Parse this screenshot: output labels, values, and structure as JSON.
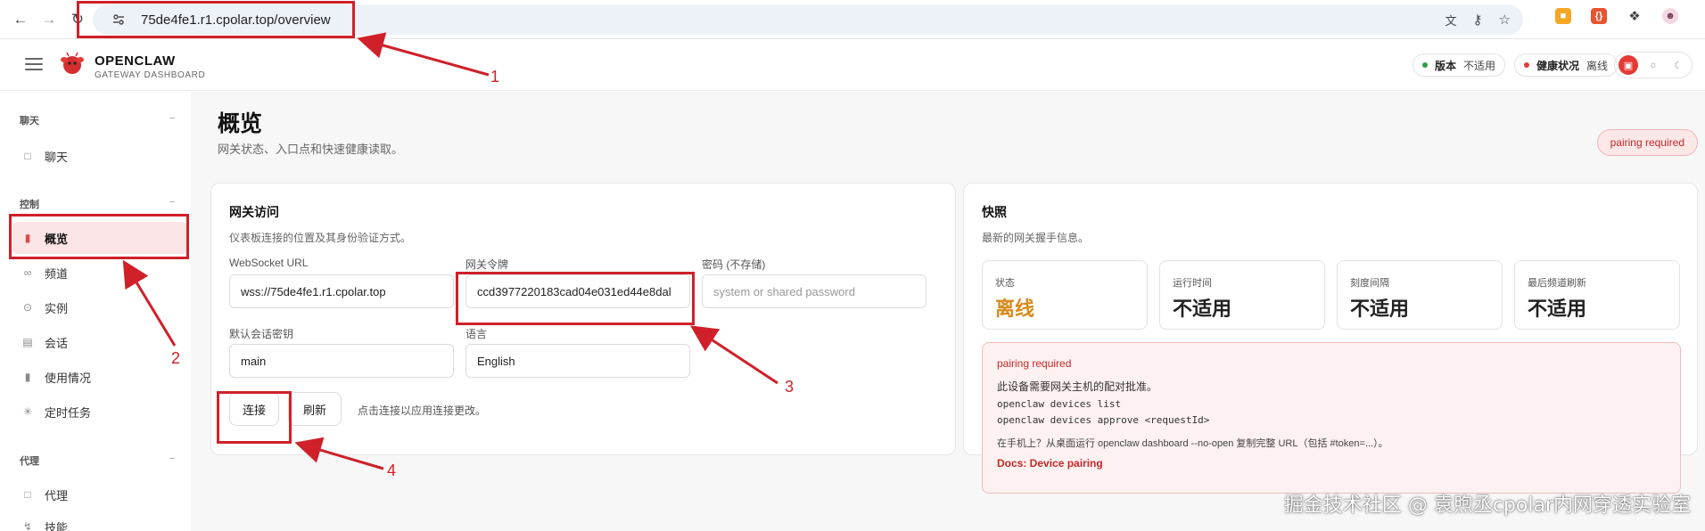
{
  "browser": {
    "url": "75de4fe1.r1.cpolar.top/overview",
    "back_icon": "arrow-left-icon",
    "forward_icon": "arrow-right-icon",
    "reload_icon": "reload-icon"
  },
  "topbar": {
    "brand_title": "OPENCLAW",
    "brand_sub": "GATEWAY DASHBOARD",
    "version_label": "版本",
    "version_value": "不适用",
    "health_label": "健康状况",
    "health_value": "离线",
    "colors": {
      "health_dot": "#e53935",
      "version_dot": "#2e9e44",
      "accent": "#e53935"
    }
  },
  "sidebar": {
    "groups": [
      {
        "label": "聊天",
        "collapse": "−",
        "items": [
          {
            "label": "聊天",
            "icon": "chat-icon"
          }
        ]
      },
      {
        "label": "控制",
        "collapse": "−",
        "items": [
          {
            "label": "概览",
            "icon": "bar-chart-icon",
            "active": true
          },
          {
            "label": "频道",
            "icon": "link-icon"
          },
          {
            "label": "实例",
            "icon": "broadcast-icon"
          },
          {
            "label": "会话",
            "icon": "document-icon"
          },
          {
            "label": "使用情况",
            "icon": "bar-chart-icon"
          },
          {
            "label": "定时任务",
            "icon": "loader-icon"
          }
        ]
      },
      {
        "label": "代理",
        "collapse": "−",
        "items": [
          {
            "label": "代理",
            "icon": "folder-icon"
          },
          {
            "label": "技能",
            "icon": "bolt-icon"
          }
        ]
      }
    ]
  },
  "page": {
    "title": "概览",
    "subtitle": "网关状态、入口点和快速健康读取。",
    "badge": "pairing required"
  },
  "gateway_card": {
    "title": "网关访问",
    "subtitle": "仪表板连接的位置及其身份验证方式。",
    "ws_label": "WebSocket URL",
    "ws_value": "wss://75de4fe1.r1.cpolar.top",
    "token_label": "网关令牌",
    "token_value": "ccd3977220183cad04e031ed44e8dal",
    "password_label": "密码 (不存储)",
    "password_placeholder": "system or shared password",
    "session_label": "默认会话密钥",
    "session_value": "main",
    "language_label": "语言",
    "language_value": "English",
    "connect_button": "连接",
    "refresh_button": "刷新",
    "hint": "点击连接以应用连接更改。"
  },
  "snapshot_card": {
    "title": "快照",
    "subtitle": "最新的网关握手信息。",
    "stats": [
      {
        "label": "状态",
        "value": "离线",
        "warn": true
      },
      {
        "label": "运行时间",
        "value": "不适用"
      },
      {
        "label": "刻度间隔",
        "value": "不适用"
      },
      {
        "label": "最后频道刷新",
        "value": "不适用"
      }
    ],
    "alert": {
      "title": "pairing required",
      "desc": "此设备需要网关主机的配对批准。",
      "code_line1": "openclaw devices list",
      "code_line2": "openclaw devices approve <requestId>",
      "tip": "在手机上？从桌面运行 openclaw dashboard --no-open 复制完整 URL（包括 #token=...）。",
      "link": "Docs: Device pairing"
    }
  },
  "annotations": {
    "n1": "1",
    "n2": "2",
    "n3": "3",
    "n4": "4"
  },
  "watermark": "掘金技术社区 @ 袁煦丞cpolar内网穿透实验室"
}
